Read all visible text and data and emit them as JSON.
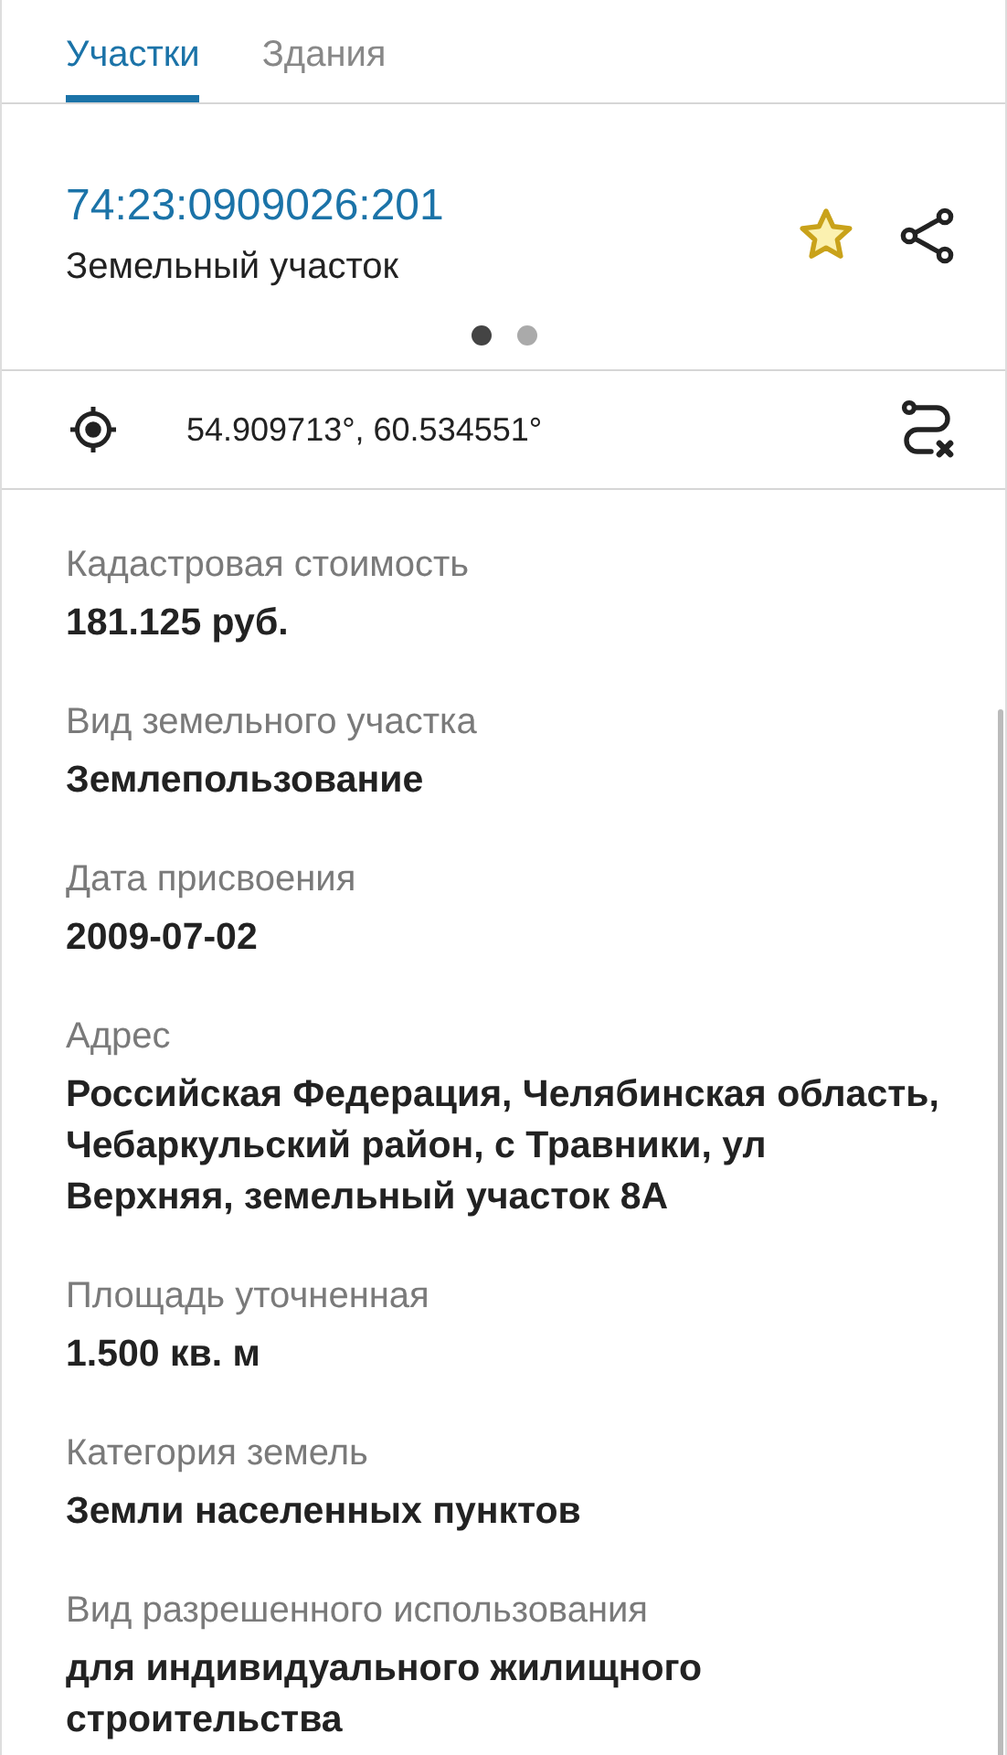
{
  "tabs": [
    {
      "label": "Участки",
      "selected": true
    },
    {
      "label": "Здания",
      "selected": false
    }
  ],
  "parcel": {
    "number": "74:23:0909026:201",
    "type": "Земельный участок"
  },
  "pages": [
    {
      "selected": true
    },
    {
      "selected": false
    }
  ],
  "location": {
    "coordinates": "54.909713°, 60.534551°"
  },
  "fields": [
    {
      "label": "Кадастровая стоимость",
      "value": "181.125 руб."
    },
    {
      "label": "Вид земельного участка",
      "value": "Землепользование"
    },
    {
      "label": "Дата присвоения",
      "value": "2009-07-02"
    },
    {
      "label": "Адрес",
      "value": "Российская Федерация, Челябинская область, Чебаркульский район, с Травники, ул Верхняя, земельный участок 8А"
    },
    {
      "label": "Площадь уточненная",
      "value": "1.500 кв. м"
    },
    {
      "label": "Категория земель",
      "value": "Земли населенных пунктов"
    },
    {
      "label": "Вид разрешенного использования",
      "value": "для индивидуального жилищного строительства"
    }
  ]
}
